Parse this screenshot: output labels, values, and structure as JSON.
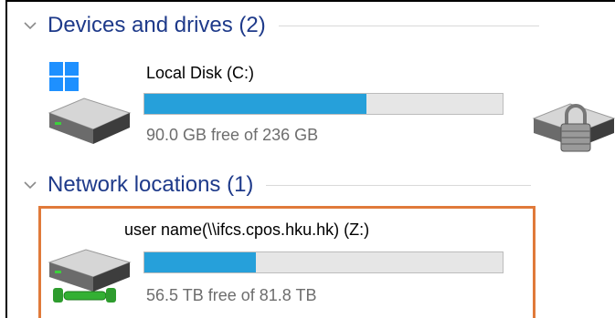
{
  "groups": {
    "devices": {
      "title": "Devices and drives (2)"
    },
    "network": {
      "title": "Network locations (1)"
    }
  },
  "drives": {
    "local": {
      "name": "Local Disk (C:)",
      "free_text": "90.0 GB free of 236 GB",
      "used_fraction": 0.62,
      "icon": "windows-drive-icon"
    },
    "locked": {
      "icon": "locked-drive-icon"
    },
    "network": {
      "name": "user name(\\\\ifcs.cpos.hku.hk) (Z:)",
      "free_text": "56.5 TB free of 81.8 TB",
      "used_fraction": 0.31,
      "icon": "network-drive-icon"
    }
  },
  "colors": {
    "accent": "#26a0da",
    "header_text": "#1e3a8a",
    "highlight": "#e07a3a"
  }
}
